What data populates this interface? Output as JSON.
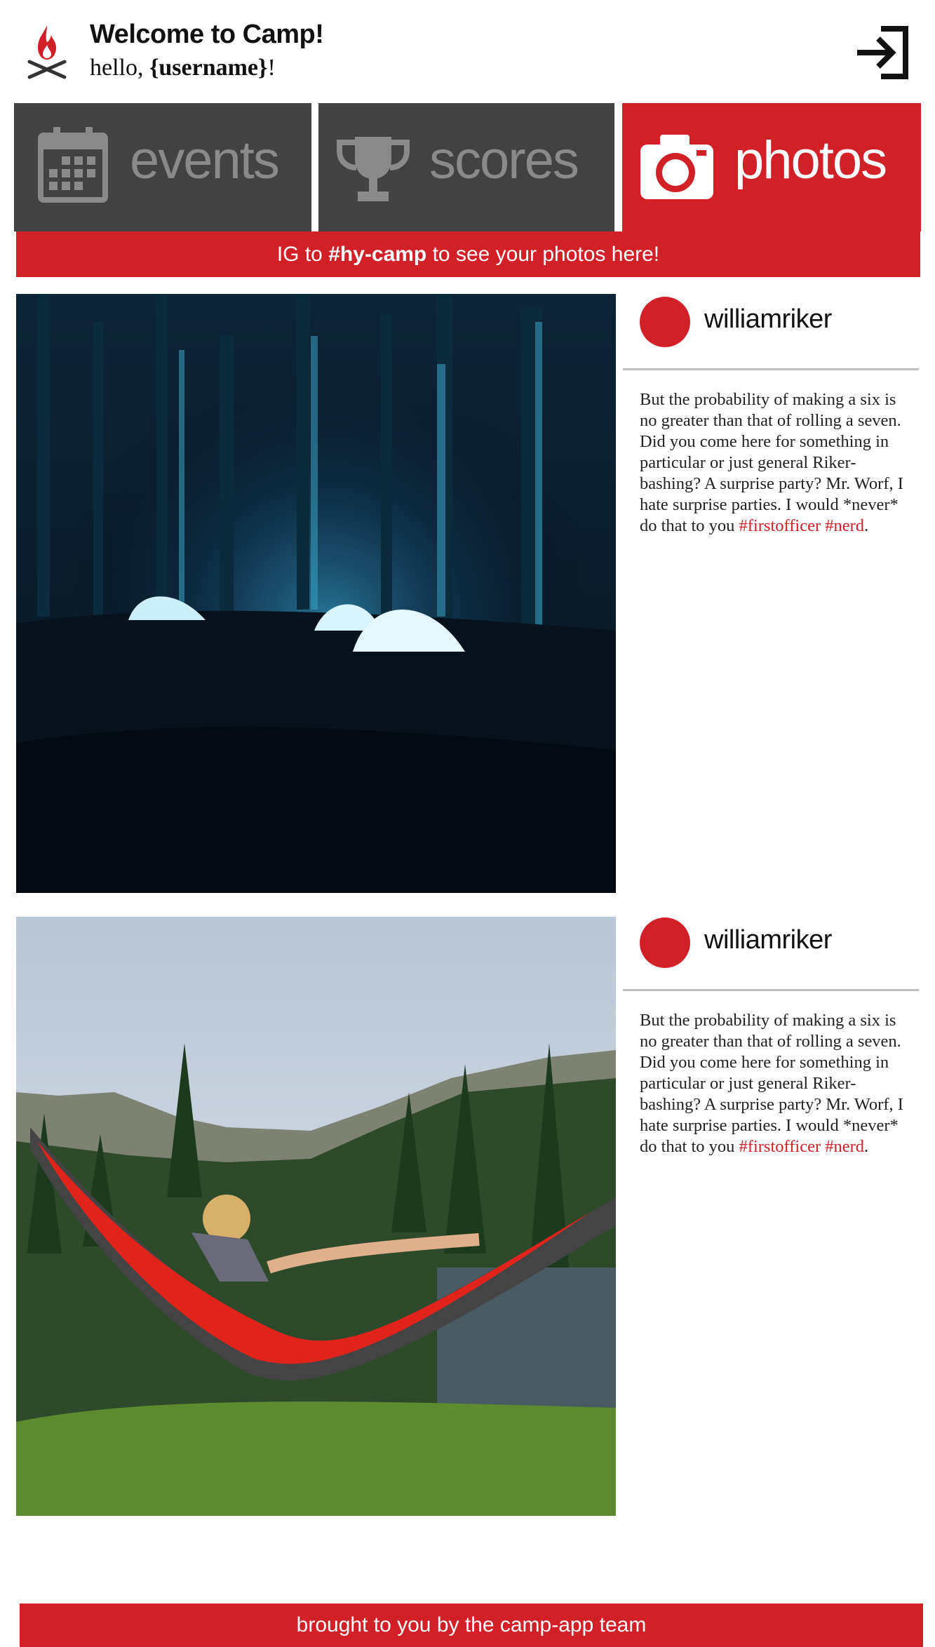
{
  "header": {
    "logo_icon": "campfire-icon",
    "title": "Welcome to Camp!",
    "greeting_prefix": "hello, ",
    "username_placeholder": "{username}",
    "greeting_suffix": "!",
    "logout_icon": "sign-in-icon"
  },
  "tabs": [
    {
      "label": "events",
      "icon": "calendar-icon",
      "active": false
    },
    {
      "label": "scores",
      "icon": "trophy-icon",
      "active": false
    },
    {
      "label": "photos",
      "icon": "camera-icon",
      "active": true
    }
  ],
  "banner": {
    "prefix": "IG to ",
    "hashtag": "#hy-camp",
    "suffix": " to see your photos here!"
  },
  "posts": [
    {
      "photo": "night-tents-forest-photo",
      "username": "williamriker",
      "caption": "But the probability of making a six is no greater than that of rolling a seven. Did you come here for something in particular or just general Riker-bashing? A surprise party? Mr. Worf, I hate surprise parties. I would *never* do that to you ",
      "tags": [
        "#firstofficer",
        "#nerd"
      ],
      "caption_end": "."
    },
    {
      "photo": "hammock-lake-photo",
      "username": "williamriker",
      "caption": "But the probability of making a six is no greater than that of rolling a seven. Did you come here for something in particular or just general Riker-bashing? A surprise party? Mr. Worf, I hate surprise parties. I would *never* do that to you ",
      "tags": [
        "#firstofficer",
        "#nerd"
      ],
      "caption_end": "."
    }
  ],
  "footer": {
    "text": "brought to you by the camp-app team"
  },
  "colors": {
    "accent": "#d22027",
    "tab_inactive": "#424242",
    "tab_text_inactive": "#8a8a8a"
  }
}
